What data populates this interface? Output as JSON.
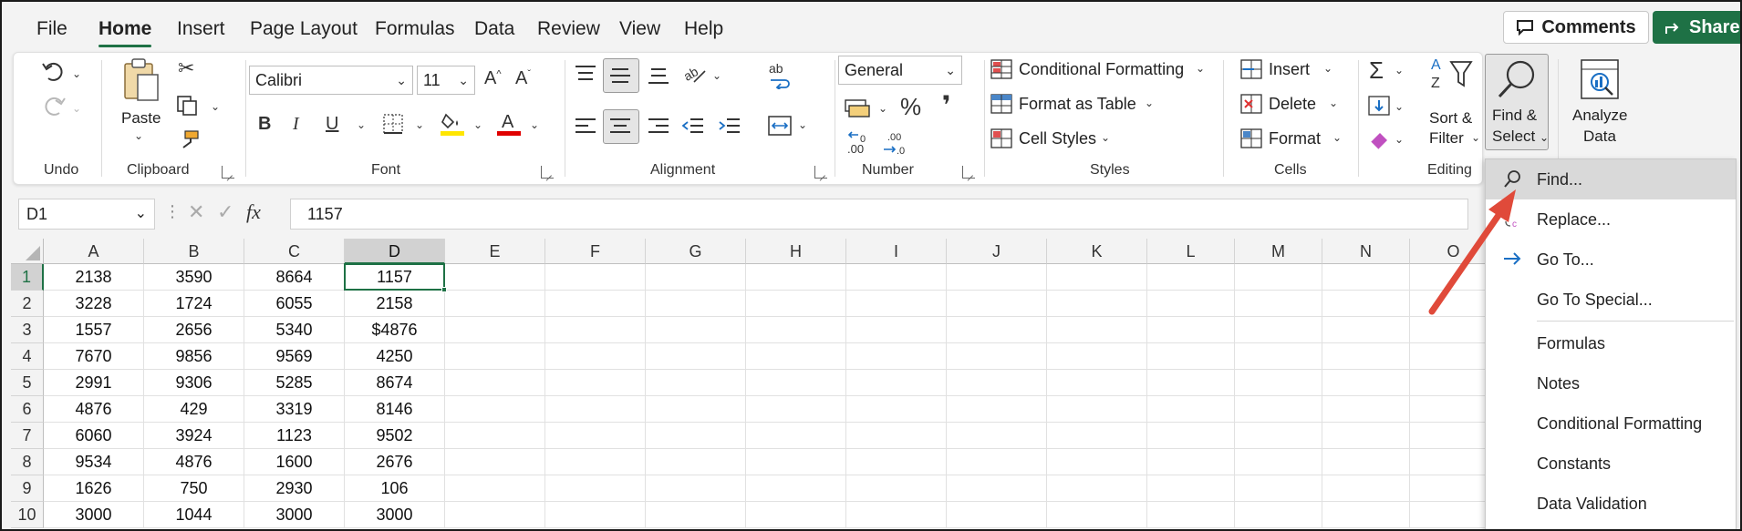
{
  "menu_tabs": [
    "File",
    "Home",
    "Insert",
    "Page Layout",
    "Formulas",
    "Data",
    "Review",
    "View",
    "Help"
  ],
  "active_tab": "Home",
  "comments_label": "Comments",
  "share_label": "Share",
  "ribbon": {
    "undo_group": "Undo",
    "clipboard_group": "Clipboard",
    "paste_label": "Paste",
    "font_group": "Font",
    "font_name": "Calibri",
    "font_size": "11",
    "alignment_group": "Alignment",
    "number_group": "Number",
    "number_format": "General",
    "styles_group": "Styles",
    "conditional_formatting": "Conditional Formatting",
    "format_as_table": "Format as Table",
    "cell_styles": "Cell Styles",
    "cells_group": "Cells",
    "insert": "Insert",
    "delete": "Delete",
    "format": "Format",
    "editing_group": "Editing",
    "sort_filter_1": "Sort &",
    "sort_filter_2": "Filter",
    "find_select_1": "Find &",
    "find_select_2": "Select",
    "analyze_1": "Analyze",
    "analyze_2": "Data"
  },
  "name_box": "D1",
  "formula_value": "1157",
  "columns": [
    "A",
    "B",
    "C",
    "D",
    "E",
    "F",
    "G",
    "H",
    "I",
    "J",
    "K",
    "L",
    "M",
    "N",
    "O"
  ],
  "selected_column": "D",
  "rows": [
    {
      "num": "1",
      "cells": [
        "2138",
        "3590",
        "8664",
        "1157"
      ]
    },
    {
      "num": "2",
      "cells": [
        "3228",
        "1724",
        "6055",
        "2158"
      ]
    },
    {
      "num": "3",
      "cells": [
        "1557",
        "2656",
        "5340",
        "$4876"
      ]
    },
    {
      "num": "4",
      "cells": [
        "7670",
        "9856",
        "9569",
        "4250"
      ]
    },
    {
      "num": "5",
      "cells": [
        "2991",
        "9306",
        "5285",
        "8674"
      ]
    },
    {
      "num": "6",
      "cells": [
        "4876",
        "429",
        "3319",
        "8146"
      ]
    },
    {
      "num": "7",
      "cells": [
        "6060",
        "3924",
        "1123",
        "9502"
      ]
    },
    {
      "num": "8",
      "cells": [
        "9534",
        "4876",
        "1600",
        "2676"
      ]
    },
    {
      "num": "9",
      "cells": [
        "1626",
        "750",
        "2930",
        "106"
      ]
    },
    {
      "num": "10",
      "cells": [
        "3000",
        "1044",
        "3000",
        "3000"
      ]
    }
  ],
  "find_menu": {
    "items": [
      {
        "label": "Find...",
        "icon": "search-icon"
      },
      {
        "label": "Replace...",
        "icon": "replace-icon"
      },
      {
        "label": "Go To...",
        "icon": "arrow-right-icon"
      },
      {
        "label": "Go To Special...",
        "icon": ""
      },
      {
        "label": "Formulas",
        "icon": ""
      },
      {
        "label": "Notes",
        "icon": ""
      },
      {
        "label": "Conditional Formatting",
        "icon": ""
      },
      {
        "label": "Constants",
        "icon": ""
      },
      {
        "label": "Data Validation",
        "icon": ""
      }
    ],
    "highlighted": "Find..."
  },
  "colors": {
    "accent_green": "#1e7145",
    "annotation_arrow": "#e04a3a",
    "highlight_yellow": "#ffe600",
    "font_red": "#e00000"
  }
}
